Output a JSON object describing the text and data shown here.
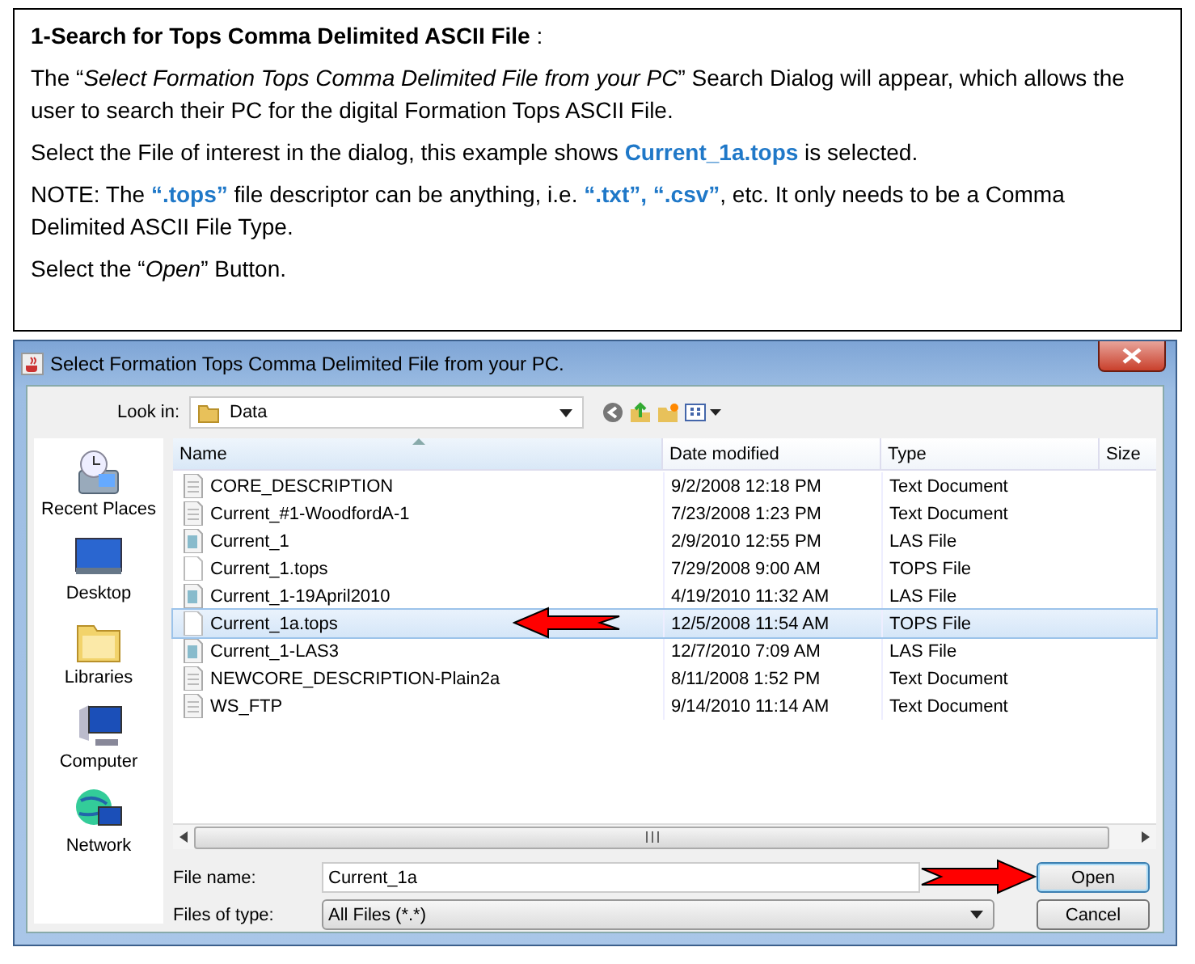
{
  "instructions": {
    "heading": "**1-Search for Tops Comma Delimited ASCII File** :",
    "paragraphs": [
      "The “*Select Formation Tops Comma Delimited File from your PC*” Search Dialog will appear, which allows the user to search their PC for the digital Formation Tops ASCII File.",
      "Select the File of interest in the dialog, this example shows **Current_1a.tops** is selected.",
      "NOTE: The **“.tops”** file descriptor can be anything, i.e. **“.txt”, “.csv”**, etc.  It only needs to be a Comma Delimited ASCII File Type.",
      "Select the “*Open*” Button."
    ]
  },
  "dialog": {
    "title": "Select Formation Tops Comma Delimited File from your PC.",
    "look_in": {
      "label": "Look in:",
      "value": "Data"
    },
    "places": [
      {
        "label": "Recent Places",
        "kind": "recent"
      },
      {
        "label": "Desktop",
        "kind": "desktop"
      },
      {
        "label": "Libraries",
        "kind": "libraries"
      },
      {
        "label": "Computer",
        "kind": "computer"
      },
      {
        "label": "Network",
        "kind": "network"
      }
    ],
    "columns": [
      "Name",
      "Date modified",
      "Type",
      "Size"
    ],
    "rows": [
      {
        "name": "CORE_DESCRIPTION",
        "date": "9/2/2008 12:18 PM",
        "type": "Text Document",
        "kind": "text",
        "selected": false
      },
      {
        "name": "Current_#1-WoodfordA-1",
        "date": "7/23/2008 1:23 PM",
        "type": "Text Document",
        "kind": "text",
        "selected": false
      },
      {
        "name": "Current_1",
        "date": "2/9/2010 12:55 PM",
        "type": "LAS File",
        "kind": "las",
        "selected": false
      },
      {
        "name": "Current_1.tops",
        "date": "7/29/2008 9:00 AM",
        "type": "TOPS File",
        "kind": "tops",
        "selected": false
      },
      {
        "name": "Current_1-19April2010",
        "date": "4/19/2010 11:32 AM",
        "type": "LAS File",
        "kind": "las",
        "selected": false
      },
      {
        "name": "Current_1a.tops",
        "date": "12/5/2008 11:54 AM",
        "type": "TOPS File",
        "kind": "tops",
        "selected": true
      },
      {
        "name": "Current_1-LAS3",
        "date": "12/7/2010 7:09 AM",
        "type": "LAS File",
        "kind": "las",
        "selected": false
      },
      {
        "name": "NEWCORE_DESCRIPTION-Plain2a",
        "date": "8/11/2008 1:52 PM",
        "type": "Text Document",
        "kind": "text",
        "selected": false
      },
      {
        "name": "WS_FTP",
        "date": "9/14/2010 11:14 AM",
        "type": "Text Document",
        "kind": "text",
        "selected": false
      }
    ],
    "file_name": {
      "label": "File name:",
      "value": "Current_1a"
    },
    "files_of_type": {
      "label": "Files of type:",
      "value": "All Files (*.*)"
    },
    "buttons": [
      {
        "label": "Open",
        "focused": true
      },
      {
        "label": "Cancel",
        "focused": false
      }
    ]
  }
}
